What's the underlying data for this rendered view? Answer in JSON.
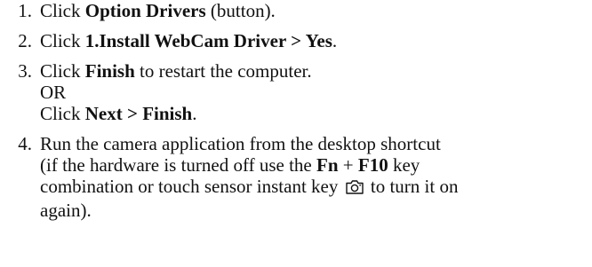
{
  "steps": [
    {
      "number": "1.",
      "pre": "Click ",
      "bold": "Option Drivers",
      "post": " (button)."
    },
    {
      "number": "2.",
      "pre": "Click ",
      "bold": "1.Install WebCam Driver > Yes",
      "post": "."
    },
    {
      "number": "3.",
      "pre": "Click ",
      "bold": "Finish",
      "post": " to restart the computer.",
      "or_text": "OR",
      "alt_pre": "Click ",
      "alt_bold": "Next > Finish",
      "alt_post": "."
    },
    {
      "number": "4.",
      "line1": "Run the camera application from the desktop shortcut",
      "line2_pre": "(if the hardware is turned off use the ",
      "key_fn": "Fn",
      "key_plus": " + ",
      "key_f10": "F10",
      "line2_post": " key",
      "line3_pre": "combination or touch sensor instant key ",
      "icon": "camera-icon",
      "line3_post": " to turn it on",
      "line4": "again)."
    }
  ]
}
